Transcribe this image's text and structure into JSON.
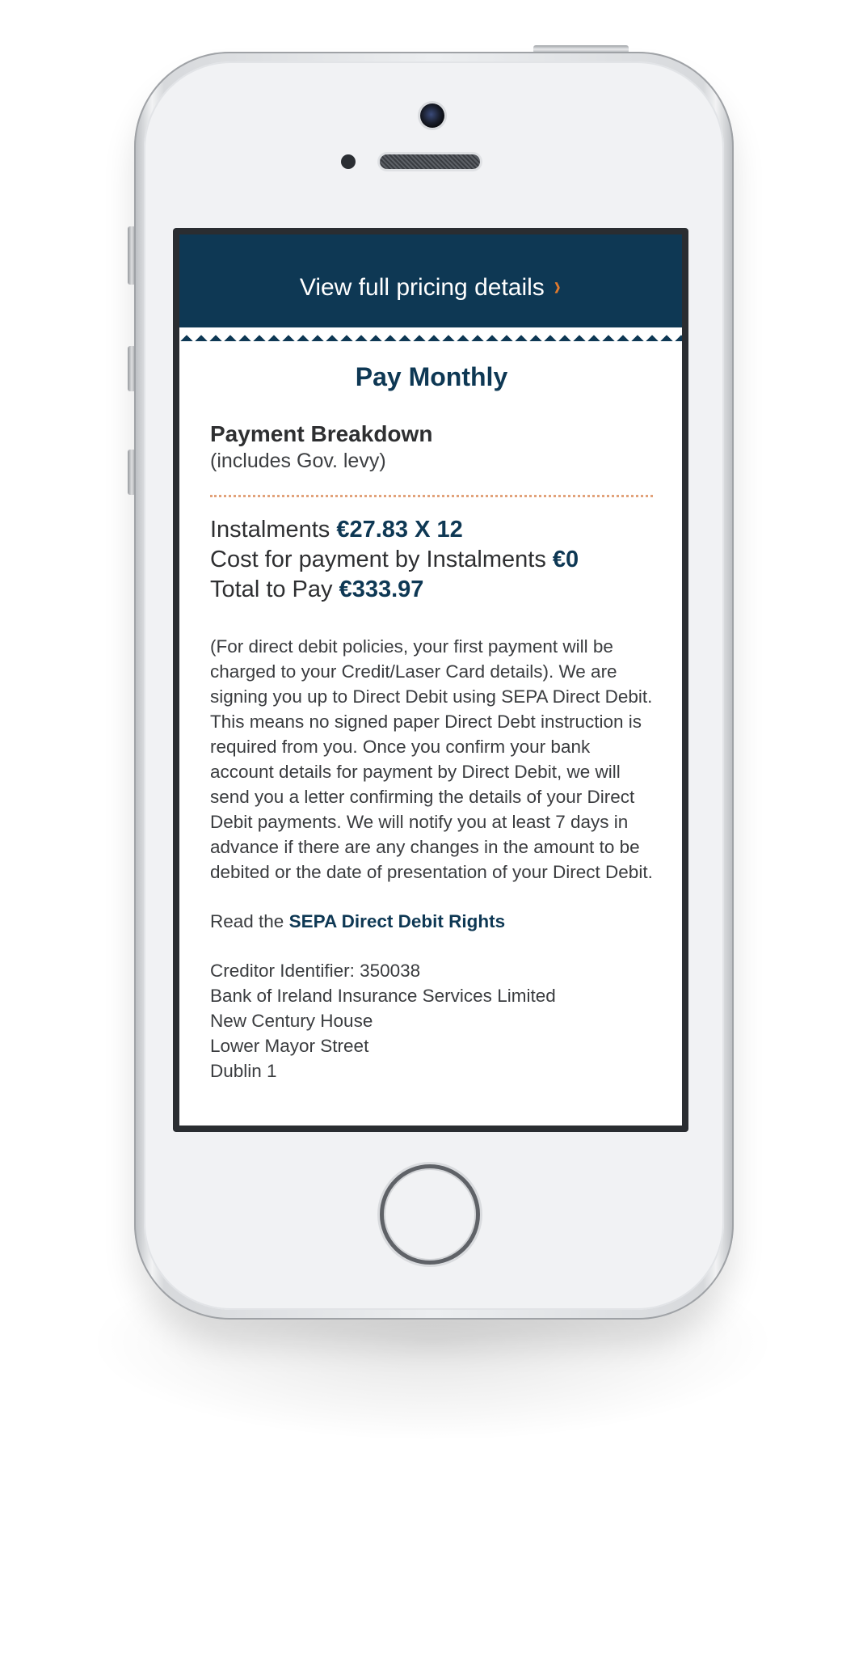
{
  "banner": {
    "link_label": "View full pricing details",
    "chevron_icon": "chevron-right-icon",
    "color": "#0e3854",
    "accent": "#e07a2e"
  },
  "plan": {
    "title": "Pay Monthly"
  },
  "breakdown": {
    "title": "Payment Breakdown",
    "subtitle": "(includes Gov. levy)"
  },
  "pricing": {
    "instalments_label": "Instalments",
    "instalments_value": "€27.83 X 12",
    "cost_label": "Cost for payment by Instalments",
    "cost_value": "€0",
    "total_label": "Total to Pay",
    "total_value": "€333.97"
  },
  "info": {
    "text": "(For direct debit policies, your first payment will be charged to your Credit/Laser Card details). We are signing you up to Direct Debit using SEPA Direct Debit. This means no signed paper Direct Debt instruction is required from you. Once you confirm your bank account details for payment by Direct Debit, we will send you a letter confirming the details of your Direct Debit payments. We will notify you at least 7 days in advance if there are any changes in the amount to be debited or the date of presentation of your Direct Debit."
  },
  "rights": {
    "prefix": "Read the",
    "link_label": "SEPA Direct Debit Rights"
  },
  "creditor": {
    "identifier": "Creditor Identifier: 350038",
    "company": "Bank of Ireland Insurance Services Limited",
    "address_line1": "New Century House",
    "address_line2": "Lower Mayor Street",
    "address_line3": "Dublin 1"
  }
}
